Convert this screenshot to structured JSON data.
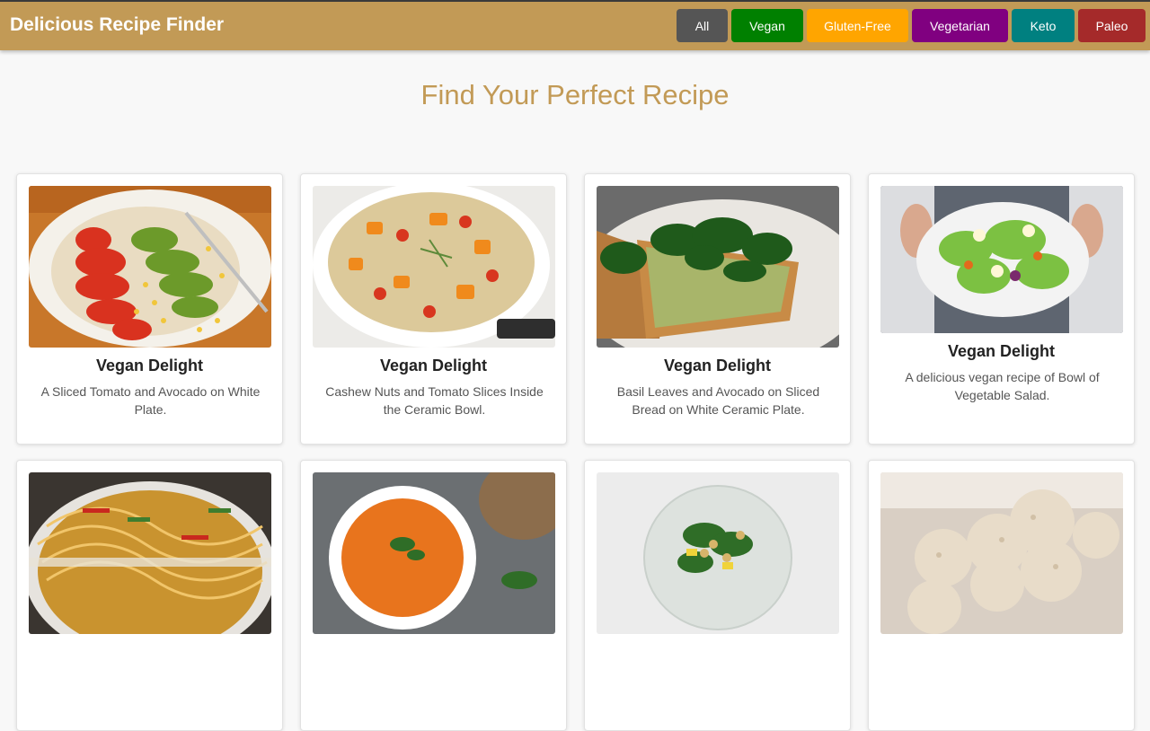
{
  "header": {
    "title": "Delicious Recipe Finder",
    "filters": [
      {
        "label": "All",
        "color": "#555555"
      },
      {
        "label": "Vegan",
        "color": "#008000"
      },
      {
        "label": "Gluten-Free",
        "color": "#ffa500"
      },
      {
        "label": "Vegetarian",
        "color": "#800080"
      },
      {
        "label": "Keto",
        "color": "#008080"
      },
      {
        "label": "Paleo",
        "color": "#a52a2a"
      }
    ]
  },
  "main": {
    "heading": "Find Your Perfect Recipe",
    "recipes": [
      {
        "title": "Vegan Delight",
        "description": "A Sliced Tomato and Avocado on White Plate.",
        "image": "tomato-avocado-plate"
      },
      {
        "title": "Vegan Delight",
        "description": "Cashew Nuts and Tomato Slices Inside the Ceramic Bowl.",
        "image": "quinoa-bowl"
      },
      {
        "title": "Vegan Delight",
        "description": "Basil Leaves and Avocado on Sliced Bread on White Ceramic Plate.",
        "image": "avocado-toast"
      },
      {
        "title": "Vegan Delight",
        "description": "A delicious vegan recipe of Bowl of Vegetable Salad.",
        "image": "vegetable-salad-bowl"
      },
      {
        "title": "",
        "description": "",
        "image": "noodles"
      },
      {
        "title": "",
        "description": "",
        "image": "tomato-soup"
      },
      {
        "title": "",
        "description": "",
        "image": "chickpea-salad"
      },
      {
        "title": "",
        "description": "",
        "image": "coconut-balls"
      }
    ]
  }
}
